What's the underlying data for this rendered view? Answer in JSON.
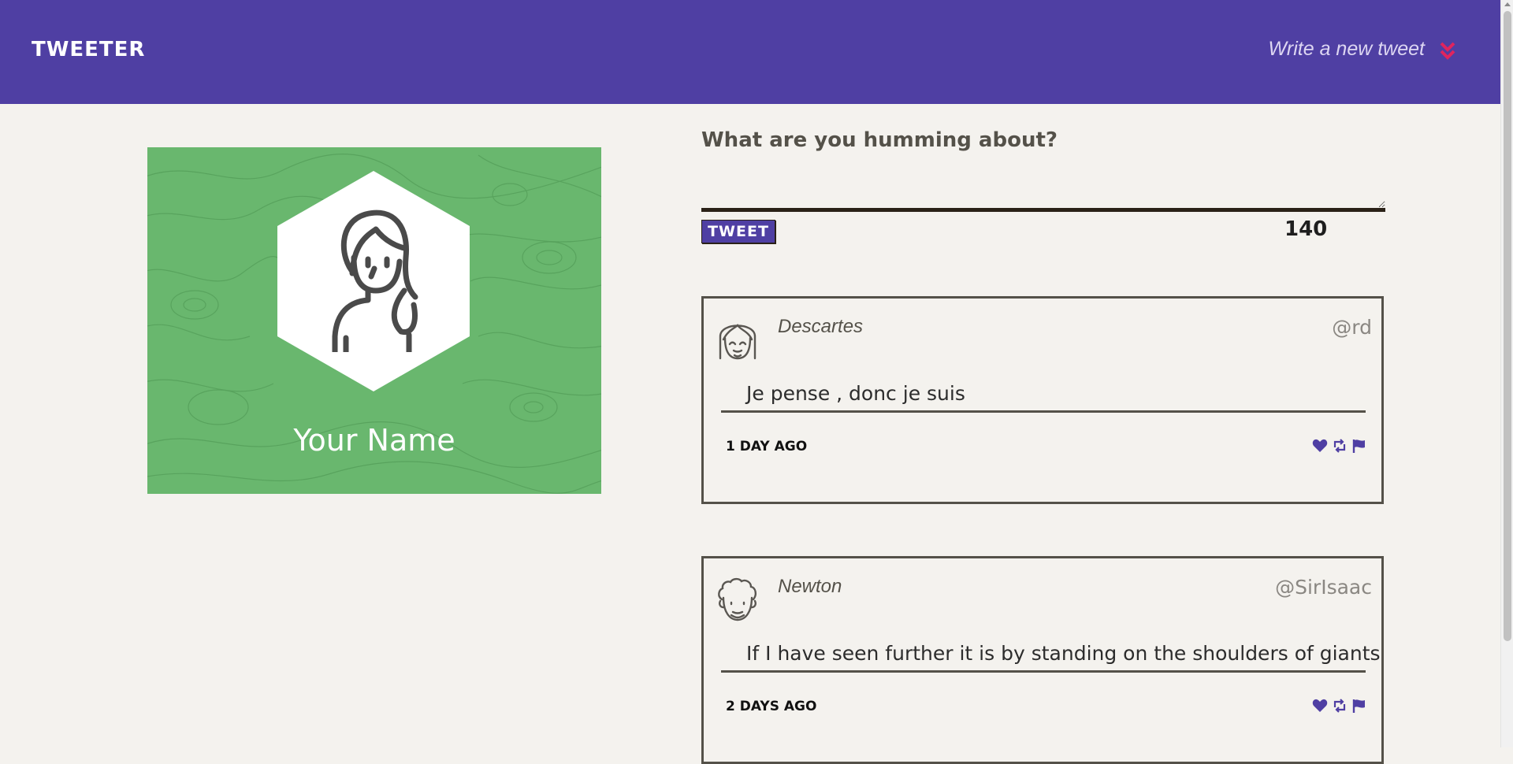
{
  "nav": {
    "brand": "TWEETER",
    "compose_link": "Write a new tweet",
    "toggle_icon": "double-chevron-down-icon",
    "toggle_color": "#e0245e"
  },
  "profile": {
    "name": "Your Name",
    "background_color": "#69b76e",
    "avatar_icon": "female-avatar-icon"
  },
  "compose": {
    "title": "What are you humming about?",
    "textarea_value": "",
    "button_label": "TWEET",
    "counter": "140"
  },
  "tweets": [
    {
      "avatar_icon": "bob-haircut-avatar-icon",
      "name": "Descartes",
      "handle": "@rd",
      "text": "Je pense , donc je suis",
      "time": "1 day ago",
      "actions": [
        "heart-icon",
        "retweet-icon",
        "flag-icon"
      ]
    },
    {
      "avatar_icon": "curly-hair-avatar-icon",
      "name": "Newton",
      "handle": "@SirIsaac",
      "text": "If I have seen further it is by standing on the shoulders of giants",
      "time": "2 days ago",
      "actions": [
        "heart-icon",
        "retweet-icon",
        "flag-icon"
      ]
    }
  ],
  "colors": {
    "nav_bg": "#4f3fa3",
    "page_bg": "#f4f2ee",
    "action_icon": "#4f3fa3"
  }
}
